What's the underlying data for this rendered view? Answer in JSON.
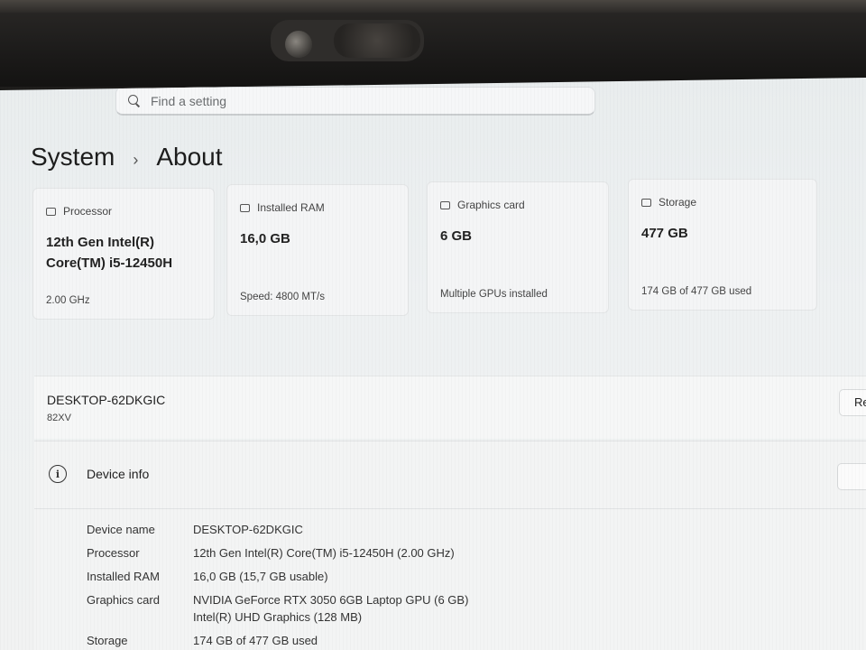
{
  "search": {
    "placeholder": "Find a setting"
  },
  "header": {
    "section": "System",
    "separator": "›",
    "page": "About"
  },
  "specs": [
    {
      "label": "Processor",
      "value_line1": "12th Gen Intel(R)",
      "value_line2": "Core(TM) i5-12450H",
      "sub": "2.00 GHz",
      "icon": "processor-icon"
    },
    {
      "label": "Installed RAM",
      "value_line1": "16,0 GB",
      "value_line2": "",
      "sub": "Speed: 4800 MT/s",
      "icon": "ram-icon"
    },
    {
      "label": "Graphics card",
      "value_line1": "6 GB",
      "value_line2": "",
      "sub": "Multiple GPUs installed",
      "icon": "graphics-card-icon"
    },
    {
      "label": "Storage",
      "value_line1": "477 GB",
      "value_line2": "",
      "sub": "174 GB of 477 GB used",
      "icon": "storage-icon"
    }
  ],
  "device": {
    "name": "DESKTOP-62DKGIC",
    "model": "82XV",
    "rename_label": "Re"
  },
  "device_info": {
    "title": "Device info",
    "rows": [
      {
        "key": "Device name",
        "value": "DESKTOP-62DKGIC",
        "value2": ""
      },
      {
        "key": "Processor",
        "value": "12th Gen Intel(R) Core(TM) i5-12450H (2.00 GHz)",
        "value2": ""
      },
      {
        "key": "Installed RAM",
        "value": "16,0 GB (15,7 GB usable)",
        "value2": ""
      },
      {
        "key": "Graphics card",
        "value": "NVIDIA GeForce RTX 3050 6GB Laptop GPU (6 GB)",
        "value2": "Intel(R) UHD Graphics (128 MB)"
      },
      {
        "key": "Storage",
        "value": "174 GB of 477 GB used",
        "value2": ""
      }
    ]
  }
}
